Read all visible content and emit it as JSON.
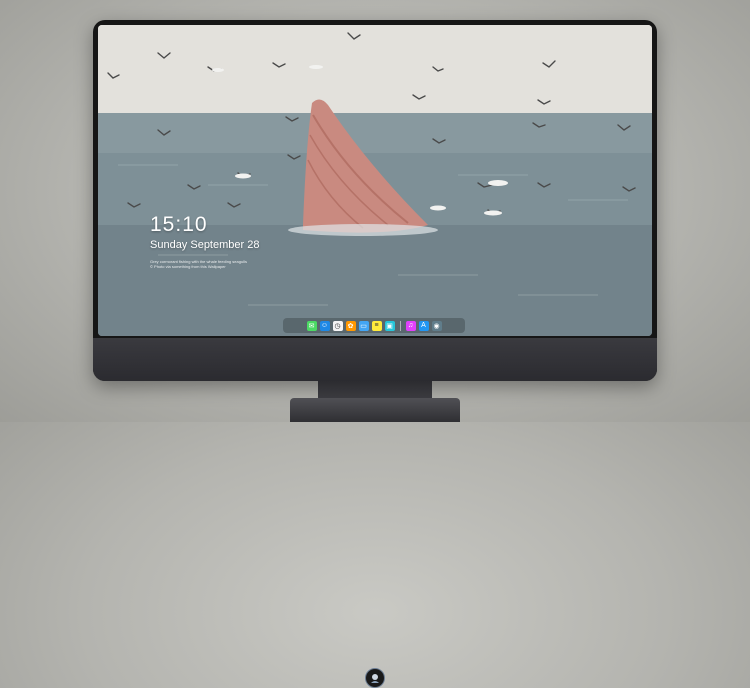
{
  "lockscreen": {
    "time": "15:10",
    "date": "Sunday September 28",
    "notice_line_1": "Grey cormorant fishing with the whale feeding seagulls",
    "notice_line_2": "© Photo via something from this Wallpaper"
  },
  "dock": {
    "apps": [
      {
        "name": "messages-icon",
        "color": "#4cd964",
        "glyph": "✉"
      },
      {
        "name": "finder-icon",
        "color": "#1e88e5",
        "glyph": "☺"
      },
      {
        "name": "clock-icon",
        "color": "#f5f5f5",
        "glyph": "◷"
      },
      {
        "name": "photos-icon",
        "color": "#ff9800",
        "glyph": "✿"
      },
      {
        "name": "folder-icon",
        "color": "#42a5f5",
        "glyph": "▭"
      },
      {
        "name": "notes-icon",
        "color": "#ffeb3b",
        "glyph": "≡"
      },
      {
        "name": "preview-icon",
        "color": "#26c6da",
        "glyph": "▣"
      },
      {
        "name": "music-icon",
        "color": "#e040fb",
        "glyph": "♫"
      },
      {
        "name": "app-store-icon",
        "color": "#2196f3",
        "glyph": "A"
      },
      {
        "name": "camera-icon",
        "color": "#607d8b",
        "glyph": "◉"
      }
    ]
  }
}
